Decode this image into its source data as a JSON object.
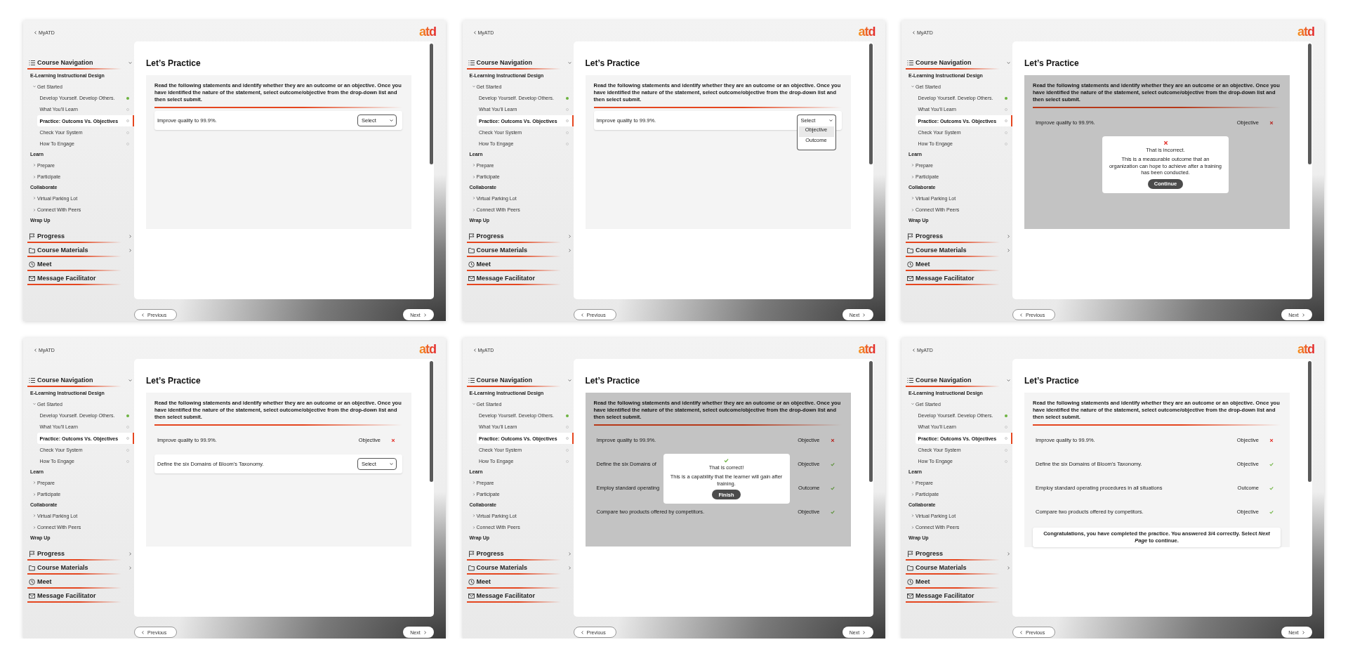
{
  "screens": [
    {
      "back_link": "MyATD",
      "logo": "atd",
      "nav": {
        "menus": [
          {
            "label": "Course Navigation",
            "expanded": true,
            "sections": [
              {
                "heading": "E-Learning Instructional Design",
                "children": [
                  {
                    "label": "Get Started",
                    "expanded": true,
                    "children": [
                      {
                        "label": "Develop Yourself. Develop Others.",
                        "completed": true,
                        "selected": false
                      },
                      {
                        "label": "What You’ll Learn",
                        "completed": false,
                        "selected": false
                      },
                      {
                        "label": "Practice: Outcoms Vs. Objectives",
                        "completed": false,
                        "selected": true
                      },
                      {
                        "label": "Check Your System",
                        "completed": false,
                        "selected": false
                      },
                      {
                        "label": "How To Engage",
                        "completed": false,
                        "selected": false
                      }
                    ]
                  }
                ]
              },
              {
                "heading": "Learn",
                "children": [
                  {
                    "label": "Prepare",
                    "expanded": false
                  },
                  {
                    "label": "Participate",
                    "expanded": false
                  }
                ]
              },
              {
                "heading": "Collaborate",
                "children": [
                  {
                    "label": "Virtual Parking Lot",
                    "expanded": false
                  },
                  {
                    "label": "Connect With Peers",
                    "expanded": false
                  }
                ]
              },
              {
                "heading": "Wrap Up"
              }
            ]
          },
          {
            "label": "Progress",
            "expanded": false
          },
          {
            "label": "Course Materials",
            "expanded": false
          },
          {
            "label": "Meet"
          },
          {
            "label": "Message Facilitator"
          }
        ]
      },
      "content": {
        "title": "Let’s Practice",
        "instructions": "Read the following statements and identify whether they are an outcome or an objective. Once you have identified the nature of the statement, select outcome/objective from the drop-down list and then select submit.",
        "items": [
          {
            "kind": "select",
            "statement": "Improve quality to 99.9%.",
            "placeholder": "Select",
            "open": false
          }
        ]
      },
      "footer": {
        "previous": "Previous",
        "next": "Next"
      }
    },
    {
      "back_link": "MyATD",
      "logo": "atd",
      "nav": {
        "menus": [
          {
            "label": "Course Navigation",
            "expanded": true,
            "sections": [
              {
                "heading": "E-Learning Instructional Design",
                "children": [
                  {
                    "label": "Get Started",
                    "expanded": true,
                    "children": [
                      {
                        "label": "Develop Yourself. Develop Others.",
                        "completed": true,
                        "selected": false
                      },
                      {
                        "label": "What You’ll Learn",
                        "completed": false,
                        "selected": false
                      },
                      {
                        "label": "Practice: Outcoms Vs. Objectives",
                        "completed": false,
                        "selected": true
                      },
                      {
                        "label": "Check Your System",
                        "completed": false,
                        "selected": false
                      },
                      {
                        "label": "How To Engage",
                        "completed": false,
                        "selected": false
                      }
                    ]
                  }
                ]
              },
              {
                "heading": "Learn",
                "children": [
                  {
                    "label": "Prepare",
                    "expanded": false
                  },
                  {
                    "label": "Participate",
                    "expanded": false
                  }
                ]
              },
              {
                "heading": "Collaborate",
                "children": [
                  {
                    "label": "Virtual Parking Lot",
                    "expanded": false
                  },
                  {
                    "label": "Connect With Peers",
                    "expanded": false
                  }
                ]
              },
              {
                "heading": "Wrap Up"
              }
            ]
          },
          {
            "label": "Progress",
            "expanded": false
          },
          {
            "label": "Course Materials",
            "expanded": false
          },
          {
            "label": "Meet"
          },
          {
            "label": "Message Facilitator"
          }
        ]
      },
      "content": {
        "title": "Let’s Practice",
        "instructions": "Read the following statements and identify whether they are an outcome or an objective. Once you have identified the nature of the statement, select outcome/objective from the drop-down list and then select submit.",
        "items": [
          {
            "kind": "select",
            "statement": "Improve quality to 99.9%.",
            "placeholder": "Select",
            "open": true,
            "options": [
              {
                "label": "Objective",
                "selected": true
              },
              {
                "label": "Outcome",
                "selected": false
              }
            ]
          }
        ]
      },
      "footer": {
        "previous": "Previous",
        "next": "Next"
      }
    },
    {
      "back_link": "MyATD",
      "logo": "atd",
      "nav": {
        "menus": [
          {
            "label": "Course Navigation",
            "expanded": true,
            "sections": [
              {
                "heading": "E-Learning Instructional Design",
                "children": [
                  {
                    "label": "Get Started",
                    "expanded": true,
                    "children": [
                      {
                        "label": "Develop Yourself. Develop Others.",
                        "completed": true,
                        "selected": false
                      },
                      {
                        "label": "What You’ll Learn",
                        "completed": false,
                        "selected": false
                      },
                      {
                        "label": "Practice: Outcoms Vs. Objectives",
                        "completed": false,
                        "selected": true
                      },
                      {
                        "label": "Check Your System",
                        "completed": false,
                        "selected": false
                      },
                      {
                        "label": "How To Engage",
                        "completed": false,
                        "selected": false
                      }
                    ]
                  }
                ]
              },
              {
                "heading": "Learn",
                "children": [
                  {
                    "label": "Prepare",
                    "expanded": false
                  },
                  {
                    "label": "Participate",
                    "expanded": false
                  }
                ]
              },
              {
                "heading": "Collaborate",
                "children": [
                  {
                    "label": "Virtual Parking Lot",
                    "expanded": false
                  },
                  {
                    "label": "Connect With Peers",
                    "expanded": false
                  }
                ]
              },
              {
                "heading": "Wrap Up"
              }
            ]
          },
          {
            "label": "Progress",
            "expanded": false
          },
          {
            "label": "Course Materials",
            "expanded": false
          },
          {
            "label": "Meet"
          },
          {
            "label": "Message Facilitator"
          }
        ]
      },
      "content": {
        "title": "Let’s Practice",
        "instructions": "Read the following statements and identify whether they are an outcome or an objective. Once you have identified the nature of the statement, select outcome/objective from the drop-down list and then select submit.",
        "items": [
          {
            "kind": "answered",
            "statement": "Improve quality to 99.9%.",
            "answer": "Objective",
            "correct": false
          }
        ],
        "dialog": {
          "correct": false,
          "title": "That is incorrect.",
          "message": "This is a measurable outcome that an organization can hope to achieve after a training has been conducted.",
          "button": "Continue"
        }
      },
      "footer": {
        "previous": "Previous",
        "next": "Next"
      }
    },
    {
      "back_link": "MyATD",
      "logo": "atd",
      "nav": {
        "menus": [
          {
            "label": "Course Navigation",
            "expanded": true,
            "sections": [
              {
                "heading": "E-Learning Instructional Design",
                "children": [
                  {
                    "label": "Get Started",
                    "expanded": true,
                    "children": [
                      {
                        "label": "Develop Yourself. Develop Others.",
                        "completed": true,
                        "selected": false
                      },
                      {
                        "label": "What You’ll Learn",
                        "completed": false,
                        "selected": false
                      },
                      {
                        "label": "Practice: Outcoms Vs. Objectives",
                        "completed": false,
                        "selected": true
                      },
                      {
                        "label": "Check Your System",
                        "completed": false,
                        "selected": false
                      },
                      {
                        "label": "How To Engage",
                        "completed": false,
                        "selected": false
                      }
                    ]
                  }
                ]
              },
              {
                "heading": "Learn",
                "children": [
                  {
                    "label": "Prepare",
                    "expanded": false
                  },
                  {
                    "label": "Participate",
                    "expanded": false
                  }
                ]
              },
              {
                "heading": "Collaborate",
                "children": [
                  {
                    "label": "Virtual Parking Lot",
                    "expanded": false
                  },
                  {
                    "label": "Connect With Peers",
                    "expanded": false
                  }
                ]
              },
              {
                "heading": "Wrap Up"
              }
            ]
          },
          {
            "label": "Progress",
            "expanded": false
          },
          {
            "label": "Course Materials",
            "expanded": false
          },
          {
            "label": "Meet"
          },
          {
            "label": "Message Facilitator"
          }
        ]
      },
      "content": {
        "title": "Let’s Practice",
        "instructions": "Read the following statements and identify whether they are an outcome or an objective. Once you have identified the nature of the statement, select outcome/objective from the drop-down list and then select submit.",
        "items": [
          {
            "kind": "answered",
            "statement": "Improve quality to 99.9%.",
            "answer": "Objective",
            "correct": false
          },
          {
            "kind": "select",
            "statement": "Define the six Domains of Bloom's Taxonomy.",
            "placeholder": "Select",
            "open": false
          }
        ]
      },
      "footer": {
        "previous": "Previous",
        "next": "Next"
      }
    },
    {
      "back_link": "MyATD",
      "logo": "atd",
      "nav": {
        "menus": [
          {
            "label": "Course Navigation",
            "expanded": true,
            "sections": [
              {
                "heading": "E-Learning Instructional Design",
                "children": [
                  {
                    "label": "Get Started",
                    "expanded": true,
                    "children": [
                      {
                        "label": "Develop Yourself. Develop Others.",
                        "completed": true,
                        "selected": false
                      },
                      {
                        "label": "What You’ll Learn",
                        "completed": false,
                        "selected": false
                      },
                      {
                        "label": "Practice: Outcoms Vs. Objectives",
                        "completed": false,
                        "selected": true
                      },
                      {
                        "label": "Check Your System",
                        "completed": false,
                        "selected": false
                      },
                      {
                        "label": "How To Engage",
                        "completed": false,
                        "selected": false
                      }
                    ]
                  }
                ]
              },
              {
                "heading": "Learn",
                "children": [
                  {
                    "label": "Prepare",
                    "expanded": false
                  },
                  {
                    "label": "Participate",
                    "expanded": false
                  }
                ]
              },
              {
                "heading": "Collaborate",
                "children": [
                  {
                    "label": "Virtual Parking Lot",
                    "expanded": false
                  },
                  {
                    "label": "Connect With Peers",
                    "expanded": false
                  }
                ]
              },
              {
                "heading": "Wrap Up"
              }
            ]
          },
          {
            "label": "Progress",
            "expanded": false
          },
          {
            "label": "Course Materials",
            "expanded": false
          },
          {
            "label": "Meet"
          },
          {
            "label": "Message Facilitator"
          }
        ]
      },
      "content": {
        "title": "Let’s Practice",
        "instructions": "Read the following statements and identify whether they are an outcome or an objective. Once you have identified the nature of the statement, select outcome/objective from the drop-down list and then select submit.",
        "items": [
          {
            "kind": "answered",
            "statement": "Improve quality to 99.9%.",
            "answer": "Objective",
            "correct": false
          },
          {
            "kind": "answered",
            "statement": "Define the six Domains of",
            "answer": "Objective",
            "correct": true
          },
          {
            "kind": "answered",
            "statement": "Employ standard operating",
            "answer": "Outcome",
            "correct": true
          },
          {
            "kind": "answered",
            "statement": "Compare two products offered by competitors.",
            "answer": "Objective",
            "correct": true
          }
        ],
        "dialog": {
          "correct": true,
          "title": "That is correct!",
          "message": "This is a capability that the learner will gain after training.",
          "button": "Finish"
        }
      },
      "footer": {
        "previous": "Previous",
        "next": "Next"
      }
    },
    {
      "back_link": "MyATD",
      "logo": "atd",
      "nav": {
        "menus": [
          {
            "label": "Course Navigation",
            "expanded": true,
            "sections": [
              {
                "heading": "E-Learning Instructional Design",
                "children": [
                  {
                    "label": "Get Started",
                    "expanded": true,
                    "children": [
                      {
                        "label": "Develop Yourself. Develop Others.",
                        "completed": true,
                        "selected": false
                      },
                      {
                        "label": "What You’ll Learn",
                        "completed": false,
                        "selected": false
                      },
                      {
                        "label": "Practice: Outcoms Vs. Objectives",
                        "completed": false,
                        "selected": true
                      },
                      {
                        "label": "Check Your System",
                        "completed": false,
                        "selected": false
                      },
                      {
                        "label": "How To Engage",
                        "completed": false,
                        "selected": false
                      }
                    ]
                  }
                ]
              },
              {
                "heading": "Learn",
                "children": [
                  {
                    "label": "Prepare",
                    "expanded": false
                  },
                  {
                    "label": "Participate",
                    "expanded": false
                  }
                ]
              },
              {
                "heading": "Collaborate",
                "children": [
                  {
                    "label": "Virtual Parking Lot",
                    "expanded": false
                  },
                  {
                    "label": "Connect With Peers",
                    "expanded": false
                  }
                ]
              },
              {
                "heading": "Wrap Up"
              }
            ]
          },
          {
            "label": "Progress",
            "expanded": false
          },
          {
            "label": "Course Materials",
            "expanded": false
          },
          {
            "label": "Meet"
          },
          {
            "label": "Message Facilitator"
          }
        ]
      },
      "content": {
        "title": "Let’s Practice",
        "instructions": "Read the following statements and identify whether they are an outcome or an objective. Once you have identified the nature of the statement, select outcome/objective from the drop-down list and then select submit.",
        "items": [
          {
            "kind": "answered",
            "statement": "Improve quality to 99.9%.",
            "answer": "Objective",
            "correct": false
          },
          {
            "kind": "answered",
            "statement": "Define the six Domains of Bloom's Taxonomy.",
            "answer": "Objective",
            "correct": true
          },
          {
            "kind": "answered",
            "statement": "Employ standard operating procedures in all situations",
            "answer": "Outcome",
            "correct": true
          },
          {
            "kind": "answered",
            "statement": "Compare two products offered by competitors.",
            "answer": "Objective",
            "correct": true
          }
        ],
        "banner": "Congratulations, you have completed the practice. You answered 3/4 correctly. Select *Next Page* to continue."
      },
      "footer": {
        "previous": "Previous",
        "next": "Next"
      }
    }
  ]
}
